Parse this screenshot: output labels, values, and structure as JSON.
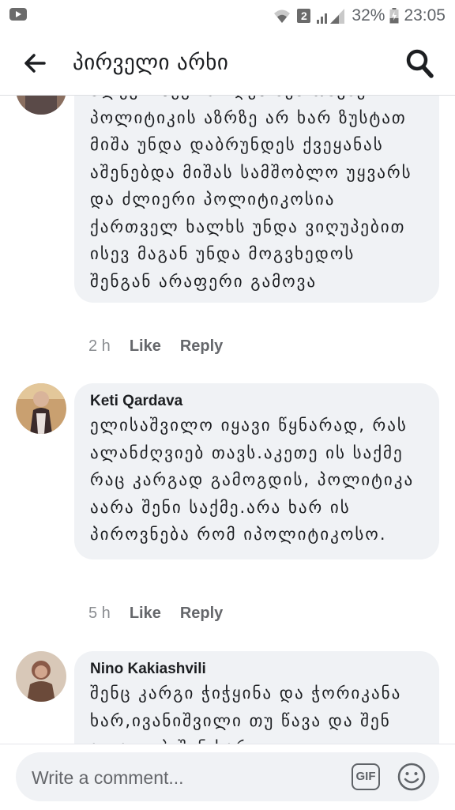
{
  "status_bar": {
    "notification_count": "2",
    "battery": "32%",
    "time": "23:05"
  },
  "header": {
    "title": "პირველი არხი"
  },
  "comments": [
    {
      "author": "",
      "text": "ალეკო ბევრს იღებ შენ თავზე პოლიტიკის აზრზე არ ხარ ზუსტათ მიშა უნდა დაბრუნდეს ქვეყანას აშენებდა მიშას სამშობლო უყვარს და ძლიერი პოლიტიკოსია ქართველ ხალხს უნდა ვიღუპებით ისევ მაგან უნდა მოგვხედოს შენგან არაფერი გამოვა",
      "time": "2 h",
      "like": "Like",
      "reply": "Reply"
    },
    {
      "author": "Keti Qardava",
      "text": "ელისაშვილო იყავი წყნარად, რას ალანძღვიებ თავს.აკეთე ის საქმე რაც კარგად გამოგდის, პოლიტიკა აარა შენი საქმე.არა ხარ ის პიროვნება რომ იპოლიტიკოსო.",
      "time": "5 h",
      "like": "Like",
      "reply": "Reply"
    },
    {
      "author": "Nino Kakiashvili",
      "text": "შენც კარგი ჭიჭყინა და ჭორიკანა ხარ,ივანიშვილი თუ წავა და შენ ალაგიებ შენ ხარ",
      "time": "",
      "like": "",
      "reply": ""
    }
  ],
  "composer": {
    "placeholder": "Write a comment...",
    "gif_label": "GIF"
  },
  "colors": {
    "bubble": "#f0f2f5",
    "text": "#1c1e21",
    "muted": "#65676b"
  }
}
